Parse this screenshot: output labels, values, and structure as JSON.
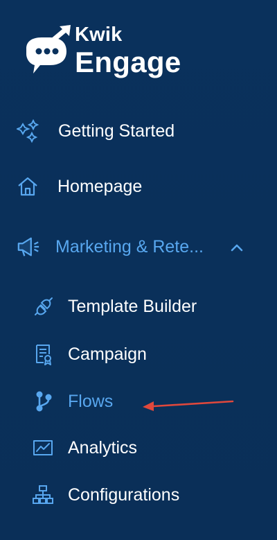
{
  "logo": {
    "line1": "Kwik",
    "line2": "Engage"
  },
  "nav": {
    "getting_started": "Getting Started",
    "homepage": "Homepage",
    "marketing": "Marketing & Rete..."
  },
  "submenu": {
    "template_builder": "Template Builder",
    "campaign": "Campaign",
    "flows": "Flows",
    "analytics": "Analytics",
    "configurations": "Configurations"
  },
  "colors": {
    "background": "#0a315c",
    "accent": "#58a7ef",
    "text": "#ffffff",
    "annotation_arrow": "#e0483c"
  },
  "icons": {
    "getting_started": "sparkle-icon",
    "homepage": "home-icon",
    "marketing": "megaphone-icon",
    "marketing_toggle": "chevron-up-icon",
    "template_builder": "plug-icon",
    "campaign": "document-badge-icon",
    "flows": "branch-icon",
    "analytics": "line-chart-icon",
    "configurations": "hierarchy-icon"
  }
}
